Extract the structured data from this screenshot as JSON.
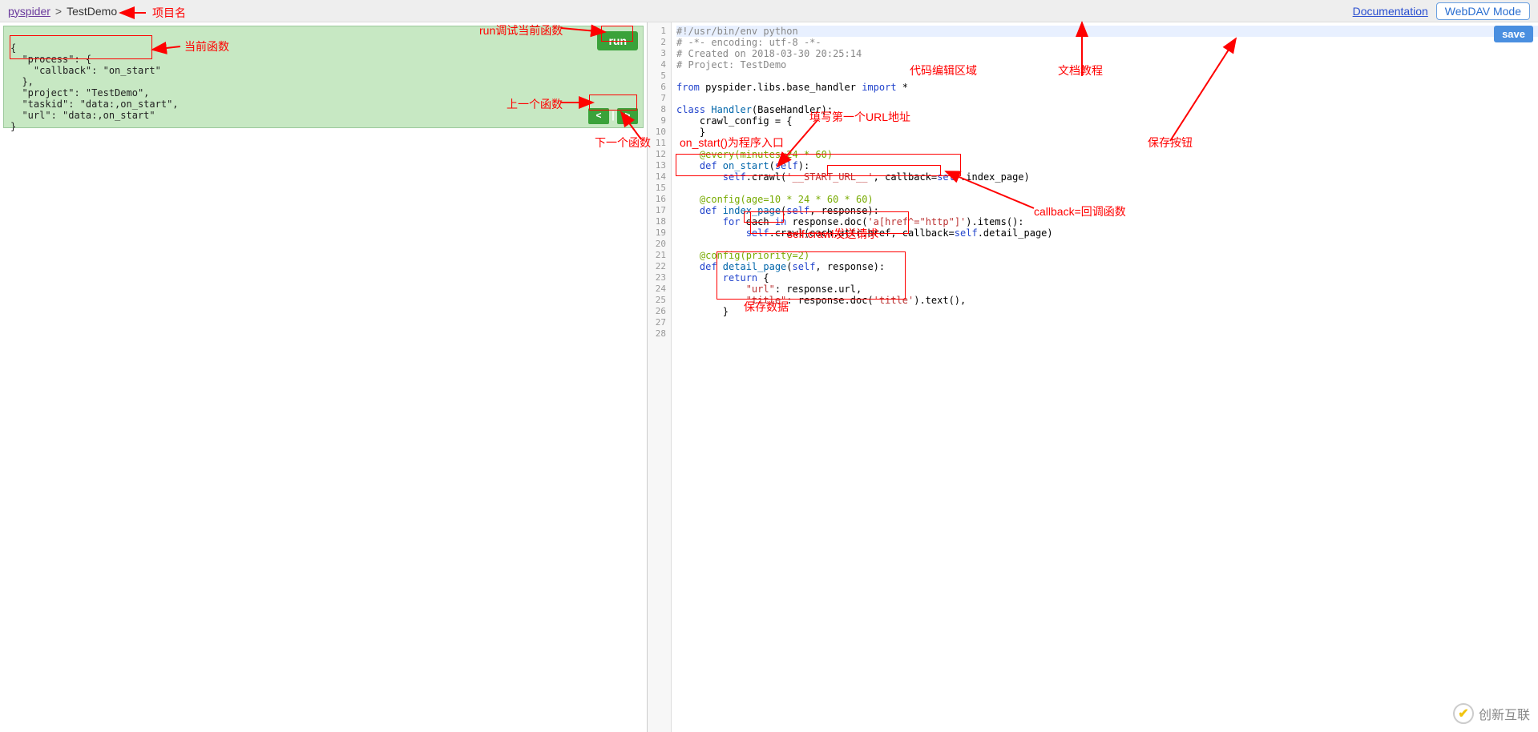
{
  "topbar": {
    "root": "pyspider",
    "sep": ">",
    "project": "TestDemo",
    "doc_link": "Documentation",
    "webdav": "WebDAV Mode"
  },
  "task": {
    "line1": "{",
    "line2": "  \"process\": {",
    "line3": "    \"callback\": \"on_start\"",
    "line4": "  },",
    "line5": "  \"project\": \"TestDemo\",",
    "line6": "  \"taskid\": \"data:,on_start\",",
    "line7": "  \"url\": \"data:,on_start\"",
    "line8": "}"
  },
  "buttons": {
    "run": "run",
    "prev": "<",
    "sep": "|",
    "next": ">",
    "save": "save"
  },
  "code": {
    "l1": "#!/usr/bin/env python",
    "l2": "# -*- encoding: utf-8 -*-",
    "l3": "# Created on 2018-03-30 20:25:14",
    "l4": "# Project: TestDemo",
    "l5": "",
    "l6a": "from",
    "l6b": " pyspider.libs.base_handler ",
    "l6c": "import",
    "l6d": " *",
    "l7": "",
    "l8a": "class",
    "l8b": " Handler",
    "l8c": "(BaseHandler):",
    "l9": "    crawl_config = {",
    "l10": "    }",
    "l11": "",
    "l12": "    @every(minutes=24 * 60)",
    "l13a": "    def ",
    "l13b": "on_start",
    "l13c": "(",
    "l13d": "self",
    "l13e": "):",
    "l14a": "        ",
    "l14b": "self",
    "l14c": ".crawl(",
    "l14d": "'__START_URL__'",
    "l14e": ", callback=",
    "l14f": "self",
    "l14g": ".index_page)",
    "l15": "",
    "l16": "    @config(age=10 * 24 * 60 * 60)",
    "l17a": "    def ",
    "l17b": "index_page",
    "l17c": "(",
    "l17d": "self",
    "l17e": ", response):",
    "l18a": "        for",
    "l18b": " each ",
    "l18c": "in",
    "l18d": " response.doc(",
    "l18e": "'a[href^=\"http\"]'",
    "l18f": ").items():",
    "l19a": "            ",
    "l19b": "self",
    "l19c": ".crawl(each.attr.href, callback=",
    "l19d": "self",
    "l19e": ".detail_page)",
    "l20": "",
    "l21": "    @config(priority=2)",
    "l22a": "    def ",
    "l22b": "detail_page",
    "l22c": "(",
    "l22d": "self",
    "l22e": ", response):",
    "l23a": "        return",
    "l23b": " {",
    "l24a": "            ",
    "l24b": "\"url\"",
    "l24c": ": response.url,",
    "l25a": "            ",
    "l25b": "\"title\"",
    "l25c": ": response.doc(",
    "l25d": "'title'",
    "l25e": ").text(),",
    "l26": "        }",
    "l27": ""
  },
  "annotations": {
    "proj_name": "项目名",
    "current_fn": "当前函数",
    "run_debug": "run调试当前函数",
    "prev_fn": "上一个函数",
    "next_fn": "下一个函数",
    "code_area": "代码编辑区域",
    "doc_tut": "文档教程",
    "save_btn": "保存按钮",
    "on_start_entry": "on_start()为程序入口",
    "fill_url": "填写第一个URL地址",
    "callback_cb": "callback=回调函数",
    "crawl_send": "self.crawl发送请求",
    "save_data": "保存数据"
  },
  "logo": "创新互联"
}
